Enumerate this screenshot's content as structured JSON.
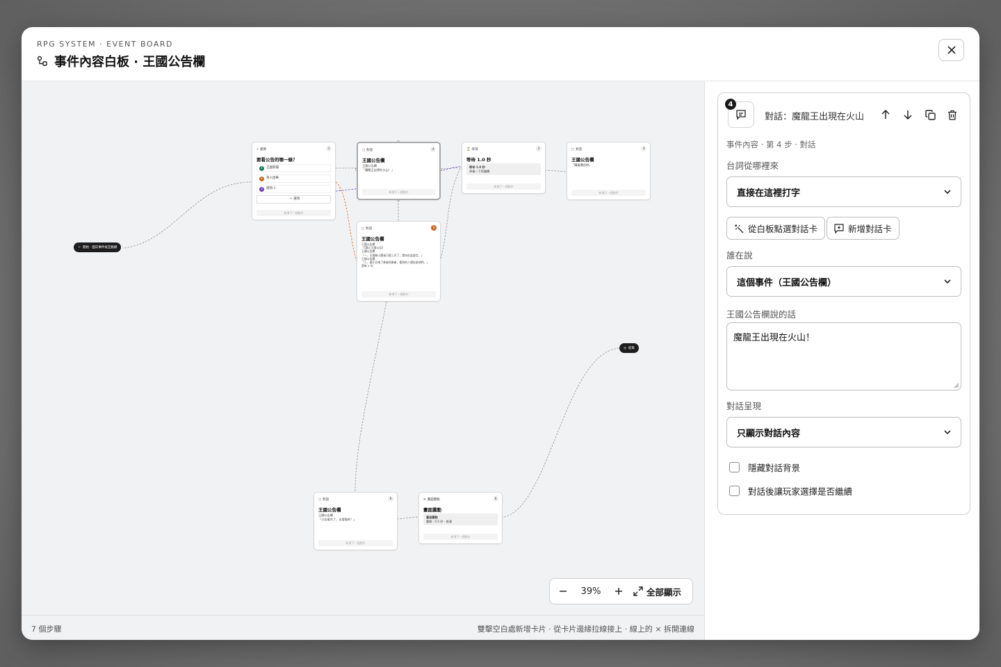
{
  "header": {
    "kicker": "RPG SYSTEM · EVENT BOARD",
    "title": "事件內容白板 · 王國公告欄"
  },
  "canvas": {
    "start_pill": "開始 · 面向事件按互動鍵",
    "end_pill": "結束",
    "add_next": "新增下一個動作",
    "cards": {
      "choice": {
        "type": "選擇",
        "num": "1",
        "title": "要看公告的哪一條？",
        "options": [
          {
            "n": "1",
            "label": "王國新聞",
            "color": "#1f7a5c"
          },
          {
            "n": "2",
            "label": "尋人啟事",
            "color": "#c46a16"
          },
          {
            "n": "3",
            "label": "選項 3",
            "color": "#6b3fb8"
          }
        ],
        "add_option": "+ 選項"
      },
      "dialog_top": {
        "type": "對話",
        "num": "4",
        "title": "王國公告欄",
        "speaker": "王國公告欄",
        "text": "「魔龍王出現在火山！」"
      },
      "wait": {
        "type": "等待",
        "num": "2",
        "title": "等待 1.0 秒",
        "inner_title": "等待 1.0 秒",
        "inner_sub": "然後一下再繼續"
      },
      "dialog_right": {
        "type": "對話",
        "num": "3",
        "title": "王國公告欄",
        "text": "「購買費用時」"
      },
      "dialog_mid": {
        "type": "對話",
        "num": "5",
        "title": "王國公告欄",
        "lines": [
          "王國公告欄",
          "「【國之王國公告】",
          "王國公告欄",
          "「一、王國騎士團長已經三天了，請勿在此留言。」",
          "王國公告欄",
          "「二、國王召喚了勇者與勇者，看到的人請告訴他們。」",
          "還有 2 句"
        ]
      },
      "dialog_bottom": {
        "type": "對話",
        "num": "6",
        "title": "王國公告欄",
        "speaker": "王國公告欄",
        "text": "「公告看完了，去冒險吧！」"
      },
      "shake": {
        "type": "畫面震動",
        "num": "6",
        "title": "畫面震動",
        "inner_title": "畫面震動",
        "inner_sub": "震動 · 0.5 秒 · 普通"
      }
    },
    "zoom": {
      "percent": "39%",
      "fit_label": "全部顯示"
    }
  },
  "footer": {
    "steps": "7 個步驟",
    "hint": "雙擊空白處新增卡片 · 從卡片邊緣拉線接上 · 線上的 × 拆開連線"
  },
  "side": {
    "badge": "4",
    "title": "對話：魔龍王出現在火山",
    "breadcrumb": "事件內容 · 第 4 步 · 對話",
    "source_label": "台詞從哪裡來",
    "source_value": "直接在這裡打字",
    "pick_btn": "從白板點選對話卡",
    "new_btn": "新增對話卡",
    "speaker_label": "誰在說",
    "speaker_value": "這個事件（王國公告欄）",
    "line_label": "王國公告欄說的話",
    "line_value": "魔龍王出現在火山！",
    "display_label": "對話呈現",
    "display_value": "只顯示對話內容",
    "cb_hide_bg": "隱藏對話背景",
    "cb_choice": "對話後讓玩家選擇是否繼續"
  },
  "colors": {
    "accent_dark": "#1d1d1d",
    "canvas_bg": "#f1f2f4",
    "wire_orange": "#d0661a",
    "wire_purple": "#6b3fb8"
  }
}
